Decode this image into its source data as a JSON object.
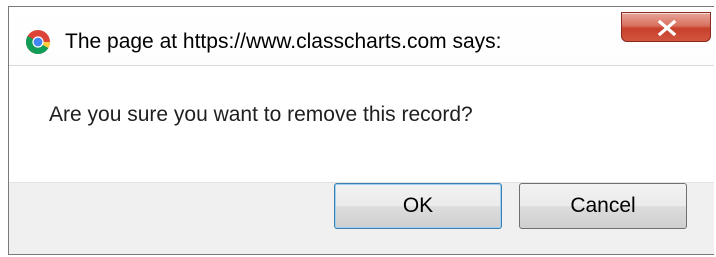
{
  "dialog": {
    "title": "The page at https://www.classcharts.com says:",
    "message": "Are you sure you want to remove this record?",
    "ok_label": "OK",
    "cancel_label": "Cancel",
    "close_icon": "close-icon",
    "browser_icon": "chrome-icon"
  },
  "colors": {
    "close_button": "#c7402a",
    "dialog_background": "#f0f0f0",
    "content_background": "#ffffff",
    "ok_border": "#3c7fb1"
  }
}
